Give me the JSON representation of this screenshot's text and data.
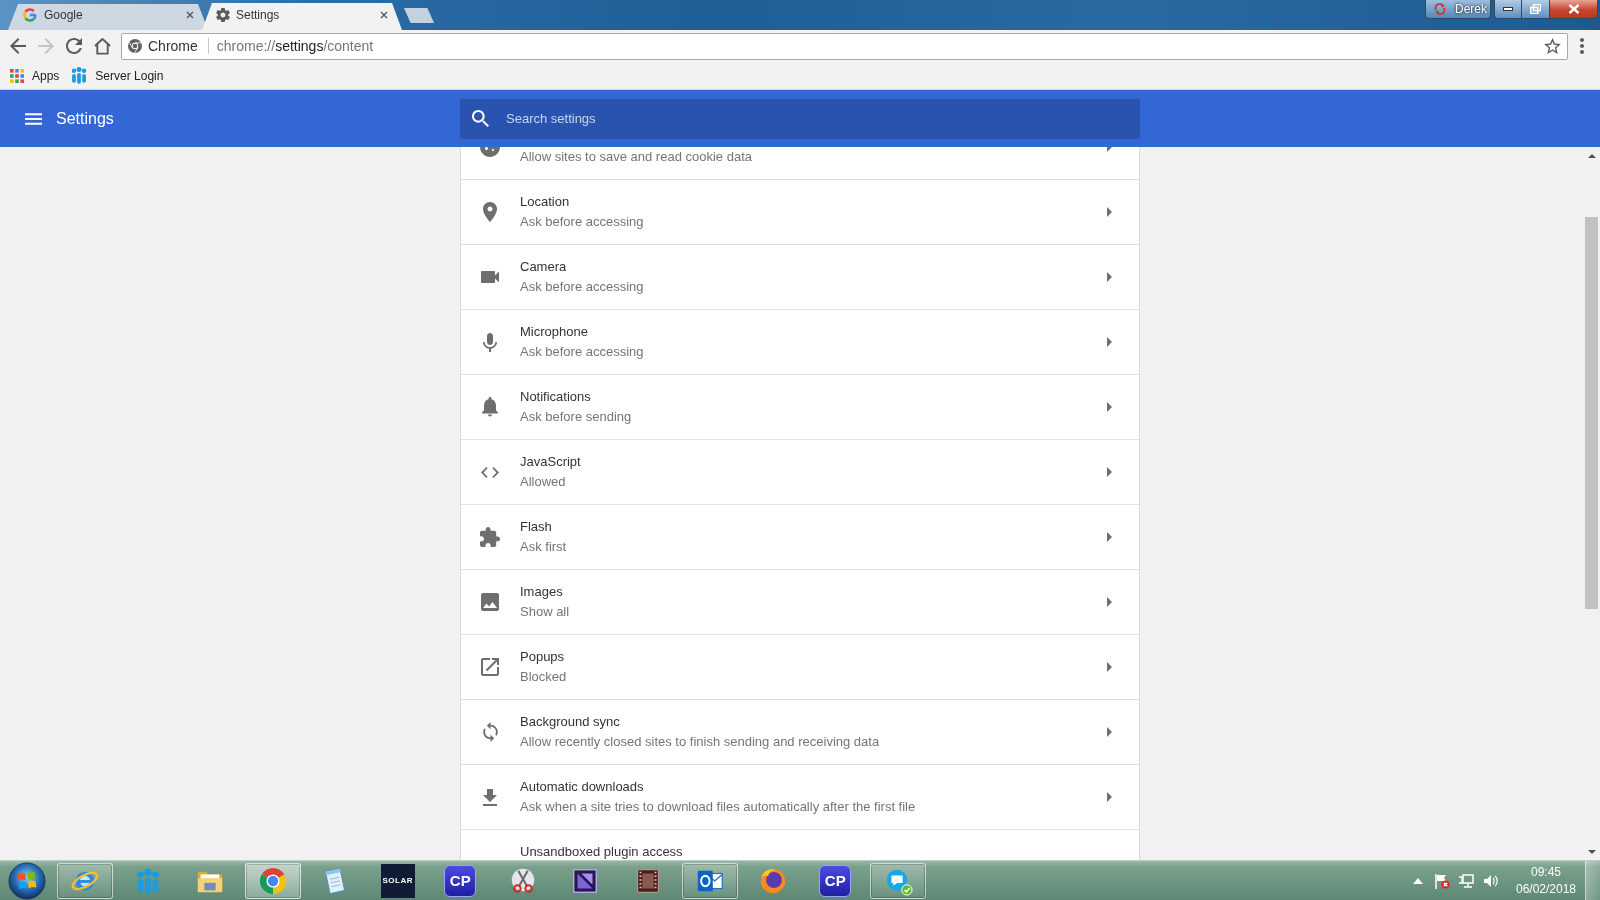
{
  "title_bar": {
    "tabs": [
      {
        "title": "Google",
        "selected": false
      },
      {
        "title": "Settings",
        "selected": true
      }
    ],
    "profile_button": {
      "label": "Derek"
    }
  },
  "toolbar": {
    "nav_buttons": [
      {
        "disabled": false
      },
      {
        "disabled": true
      },
      {
        "disabled": false
      },
      {
        "disabled": false
      }
    ],
    "omnibox": {
      "chip": "Chrome",
      "url": {
        "scheme": "chrome://",
        "host": "settings",
        "path": "/content"
      }
    }
  },
  "bookmarks_bar": {
    "items": [
      {
        "label": "Apps"
      },
      {
        "label": "Server Login"
      }
    ]
  },
  "header": {
    "title": "Settings",
    "search": {
      "placeholder": "Search settings"
    }
  },
  "settings_rows": [
    {
      "subtitle": "Allow sites to save and read cookie data"
    },
    {
      "title": "Location",
      "subtitle": "Ask before accessing"
    },
    {
      "title": "Camera",
      "subtitle": "Ask before accessing"
    },
    {
      "title": "Microphone",
      "subtitle": "Ask before accessing"
    },
    {
      "title": "Notifications",
      "subtitle": "Ask before sending"
    },
    {
      "title": "JavaScript",
      "subtitle": "Allowed"
    },
    {
      "title": "Flash",
      "subtitle": "Ask first"
    },
    {
      "title": "Images",
      "subtitle": "Show all"
    },
    {
      "title": "Popups",
      "subtitle": "Blocked"
    },
    {
      "title": "Background sync",
      "subtitle": "Allow recently closed sites to finish sending and receiving data"
    },
    {
      "title": "Automatic downloads",
      "subtitle": "Ask when a site tries to download files automatically after the first file"
    },
    {
      "title": "Unsandboxed plugin access"
    }
  ],
  "taskbar": {
    "apps": [
      {
        "running": true,
        "selected": false
      },
      {
        "running": false,
        "selected": false
      },
      {
        "running": false,
        "selected": false
      },
      {
        "running": true,
        "selected": true
      },
      {
        "running": false,
        "selected": false
      },
      {
        "label": "SOLAR",
        "running": false,
        "selected": false
      },
      {
        "label": "CP",
        "running": false,
        "selected": false
      },
      {
        "running": false,
        "selected": false
      },
      {
        "running": false,
        "selected": false
      },
      {
        "running": false,
        "selected": false
      },
      {
        "running": true,
        "selected": false
      },
      {
        "running": false,
        "selected": false
      },
      {
        "label": "CP",
        "running": false,
        "selected": false
      },
      {
        "running": true,
        "selected": false
      }
    ],
    "clock": {
      "time": "09:45",
      "date": "06/02/2018"
    }
  }
}
